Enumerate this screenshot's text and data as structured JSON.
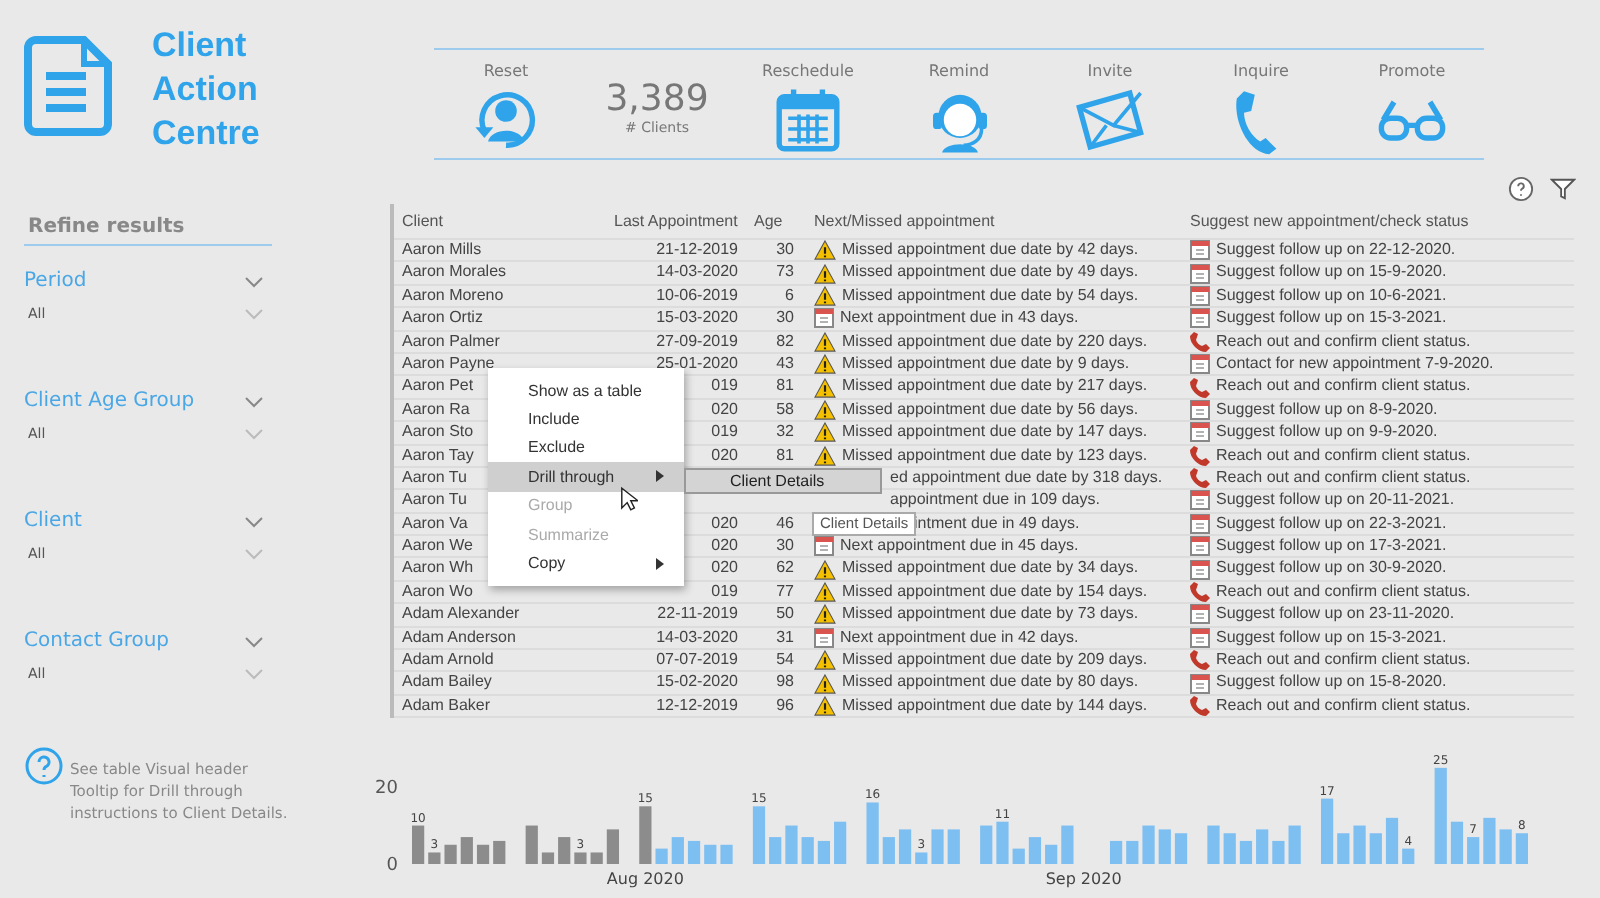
{
  "header": {
    "title": "Client Action Centre"
  },
  "actions": [
    {
      "kind": "reset",
      "label": "Reset"
    },
    {
      "kind": "count",
      "value": "3,389",
      "label": "# Clients"
    },
    {
      "kind": "calendar",
      "label": "Reschedule"
    },
    {
      "kind": "headset",
      "label": "Remind"
    },
    {
      "kind": "envelope",
      "label": "Invite"
    },
    {
      "kind": "phone",
      "label": "Inquire"
    },
    {
      "kind": "glasses",
      "label": "Promote"
    }
  ],
  "sidebar": {
    "title": "Refine results",
    "filters": [
      {
        "label": "Period",
        "value": "All"
      },
      {
        "label": "Client Age Group",
        "value": "All"
      },
      {
        "label": "Client",
        "value": "All"
      },
      {
        "label": "Contact Group",
        "value": "All"
      }
    ],
    "help": "See table Visual header Tooltip for Drill through instructions to Client Details."
  },
  "table": {
    "columns": [
      "Client",
      "Last Appointment",
      "Age",
      "Next/Missed appointment",
      "Suggest new appointment/check status"
    ],
    "rows": [
      {
        "client": "Aaron Mills",
        "last": "21-12-2019",
        "age": "30",
        "next": {
          "kind": "warning",
          "text": "Missed appointment due date by 42 days."
        },
        "suggest": {
          "kind": "calendar",
          "text": "Suggest follow up on 22-12-2020."
        }
      },
      {
        "client": "Aaron Morales",
        "last": "14-03-2020",
        "age": "73",
        "next": {
          "kind": "warning",
          "text": "Missed appointment due date by 49 days."
        },
        "suggest": {
          "kind": "calendar",
          "text": "Suggest follow up on 15-9-2020."
        }
      },
      {
        "client": "Aaron Moreno",
        "last": "10-06-2019",
        "age": "6",
        "next": {
          "kind": "warning",
          "text": "Missed appointment due date by 54 days."
        },
        "suggest": {
          "kind": "calendar",
          "text": "Suggest follow up on 10-6-2021."
        }
      },
      {
        "client": "Aaron Ortiz",
        "last": "15-03-2020",
        "age": "30",
        "next": {
          "kind": "calendar",
          "text": "Next appointment due in 43 days."
        },
        "suggest": {
          "kind": "calendar",
          "text": "Suggest follow up on 15-3-2021."
        }
      },
      {
        "client": "Aaron Palmer",
        "last": "27-09-2019",
        "age": "82",
        "next": {
          "kind": "warning",
          "text": "Missed appointment due date by 220 days."
        },
        "suggest": {
          "kind": "phone",
          "text": "Reach out and confirm client status."
        }
      },
      {
        "client": "Aaron Payne",
        "last": "25-01-2020",
        "age": "43",
        "next": {
          "kind": "warning",
          "text": "Missed appointment due date by 9 days."
        },
        "suggest": {
          "kind": "calendar",
          "text": "Contact for new appointment 7-9-2020."
        }
      },
      {
        "client": "Aaron Pet",
        "last": "019",
        "age": "81",
        "next": {
          "kind": "warning",
          "text": "Missed appointment due date by 217 days."
        },
        "suggest": {
          "kind": "phone",
          "text": "Reach out and confirm client status."
        }
      },
      {
        "client": "Aaron Ra",
        "last": "020",
        "age": "58",
        "next": {
          "kind": "warning",
          "text": "Missed appointment due date by 56 days."
        },
        "suggest": {
          "kind": "calendar",
          "text": "Suggest follow up on 8-9-2020."
        }
      },
      {
        "client": "Aaron Sto",
        "last": "019",
        "age": "32",
        "next": {
          "kind": "warning",
          "text": "Missed appointment due date by 147 days."
        },
        "suggest": {
          "kind": "calendar",
          "text": "Suggest follow up on 9-9-2020."
        }
      },
      {
        "client": "Aaron Tay",
        "last": "020",
        "age": "81",
        "next": {
          "kind": "warning",
          "text": "Missed appointment due date by 123 days."
        },
        "suggest": {
          "kind": "phone",
          "text": "Reach out and confirm client status."
        }
      },
      {
        "client": "Aaron Tu",
        "next": {
          "kind": "aftermenu",
          "text": "ed appointment due date by 318 days."
        },
        "suggest": {
          "kind": "phone",
          "text": "Reach out and confirm client status."
        }
      },
      {
        "client": "Aaron Tu",
        "next": {
          "kind": "aftermenu",
          "text": "appointment due in 109 days."
        },
        "suggest": {
          "kind": "calendar",
          "text": "Suggest follow up on 20-11-2021."
        }
      },
      {
        "client": "Aaron Va",
        "last": "020",
        "age": "46",
        "next": {
          "kind": "aftertip",
          "text": "intment due in 49 days."
        },
        "suggest": {
          "kind": "calendar",
          "text": "Suggest follow up on 22-3-2021."
        }
      },
      {
        "client": "Aaron We",
        "last": "020",
        "age": "30",
        "next": {
          "kind": "calendar",
          "text": "Next appointment due in 45 days."
        },
        "suggest": {
          "kind": "calendar",
          "text": "Suggest follow up on 17-3-2021."
        }
      },
      {
        "client": "Aaron Wh",
        "last": "020",
        "age": "62",
        "next": {
          "kind": "warning",
          "text": "Missed appointment due date by 34 days."
        },
        "suggest": {
          "kind": "calendar",
          "text": "Suggest follow up on 30-9-2020."
        }
      },
      {
        "client": "Aaron Wo",
        "last": "019",
        "age": "77",
        "next": {
          "kind": "warning",
          "text": "Missed appointment due date by 154 days."
        },
        "suggest": {
          "kind": "phone",
          "text": "Reach out and confirm client status."
        }
      },
      {
        "client": "Adam Alexander",
        "last": "22-11-2019",
        "age": "50",
        "next": {
          "kind": "warning",
          "text": "Missed appointment due date by 73 days."
        },
        "suggest": {
          "kind": "calendar",
          "text": "Suggest follow up on 23-11-2020."
        }
      },
      {
        "client": "Adam Anderson",
        "last": "14-03-2020",
        "age": "31",
        "next": {
          "kind": "calendar",
          "text": "Next appointment due in 42 days."
        },
        "suggest": {
          "kind": "calendar",
          "text": "Suggest follow up on 15-3-2021."
        }
      },
      {
        "client": "Adam Arnold",
        "last": "07-07-2019",
        "age": "54",
        "next": {
          "kind": "warning",
          "text": "Missed appointment due date by 209 days."
        },
        "suggest": {
          "kind": "phone",
          "text": "Reach out and confirm client status."
        }
      },
      {
        "client": "Adam Bailey",
        "last": "15-02-2020",
        "age": "98",
        "next": {
          "kind": "warning",
          "text": "Missed appointment due date by 80 days."
        },
        "suggest": {
          "kind": "calendar",
          "text": "Suggest follow up on 15-8-2020."
        }
      },
      {
        "client": "Adam Baker",
        "last": "12-12-2019",
        "age": "96",
        "next": {
          "kind": "warning",
          "text": "Missed appointment due date by 144 days."
        },
        "suggest": {
          "kind": "phone",
          "text": "Reach out and confirm client status."
        }
      }
    ]
  },
  "context_menu": {
    "items": [
      {
        "label": "Show as a table",
        "selected": false,
        "disabled": false,
        "submenu": false
      },
      {
        "label": "Include",
        "selected": false,
        "disabled": false,
        "submenu": false
      },
      {
        "label": "Exclude",
        "selected": false,
        "disabled": false,
        "submenu": false
      },
      {
        "label": "Drill through",
        "selected": true,
        "disabled": false,
        "submenu": true
      },
      {
        "label": "Group",
        "selected": false,
        "disabled": true,
        "submenu": false
      },
      {
        "label": "Summarize",
        "selected": false,
        "disabled": true,
        "submenu": false
      },
      {
        "label": "Copy",
        "selected": false,
        "disabled": false,
        "submenu": true
      }
    ],
    "submenu": [
      "Client Details"
    ],
    "tooltip": "Client Details"
  },
  "chart": {
    "chart_data": {
      "type": "bar",
      "stacked": true,
      "ylim": [
        0,
        26
      ],
      "yticks": [
        0,
        20
      ],
      "categories": [
        null,
        null,
        null,
        null,
        null,
        null,
        null,
        null,
        null,
        null,
        null,
        null,
        null,
        null,
        "Aug 2020",
        null,
        null,
        null,
        null,
        null,
        null,
        null,
        null,
        null,
        null,
        null,
        null,
        null,
        null,
        null,
        null,
        null,
        null,
        null,
        null,
        null,
        null,
        null,
        null,
        null,
        null,
        "Sep 2020",
        null,
        null,
        null,
        null,
        null,
        null,
        null,
        null,
        null,
        null,
        null,
        null,
        null,
        null,
        null,
        null,
        null,
        null,
        null,
        null,
        null,
        null,
        null,
        null,
        null,
        null,
        null
      ],
      "series": [
        {
          "color": "#8c8c8c",
          "values": [
            10,
            3,
            5,
            7,
            5,
            6,
            null,
            10,
            3,
            7,
            3,
            3,
            9,
            null,
            15,
            null,
            null,
            null,
            null,
            null,
            null,
            null,
            null,
            null,
            null,
            null,
            null,
            null,
            null,
            null,
            null,
            null,
            null,
            null,
            null,
            null,
            null,
            null,
            null,
            null,
            null,
            null,
            null,
            null,
            null,
            null,
            null,
            null,
            null,
            null,
            null,
            null,
            null,
            null,
            null,
            null,
            null,
            null,
            null,
            null,
            null,
            null,
            null,
            null,
            null,
            null,
            null,
            null,
            null
          ]
        },
        {
          "color": "#7ebff2",
          "values": [
            null,
            null,
            null,
            null,
            null,
            null,
            null,
            null,
            null,
            null,
            null,
            null,
            null,
            null,
            null,
            4,
            7,
            6,
            5,
            5,
            null,
            15,
            7,
            10,
            7,
            6,
            11,
            null,
            16,
            7,
            9,
            3,
            9,
            9,
            null,
            10,
            11,
            4,
            7,
            5,
            10,
            null,
            null,
            6,
            6,
            10,
            9,
            8,
            null,
            10,
            8,
            6,
            9,
            6,
            10,
            null,
            17,
            8,
            10,
            8,
            12,
            4,
            null,
            25,
            11,
            7,
            12,
            9,
            8
          ]
        }
      ],
      "value_labels": [
        "10",
        "3",
        null,
        null,
        null,
        null,
        null,
        null,
        null,
        null,
        "3",
        null,
        null,
        null,
        "15",
        null,
        null,
        null,
        null,
        null,
        null,
        "15",
        null,
        null,
        null,
        null,
        null,
        null,
        "16",
        null,
        null,
        "3",
        null,
        null,
        null,
        null,
        "11",
        null,
        null,
        null,
        null,
        null,
        null,
        null,
        null,
        null,
        null,
        null,
        null,
        null,
        null,
        null,
        null,
        null,
        null,
        null,
        "17",
        null,
        null,
        null,
        null,
        "4",
        null,
        "25",
        null,
        "7",
        null,
        null,
        "8"
      ]
    }
  }
}
